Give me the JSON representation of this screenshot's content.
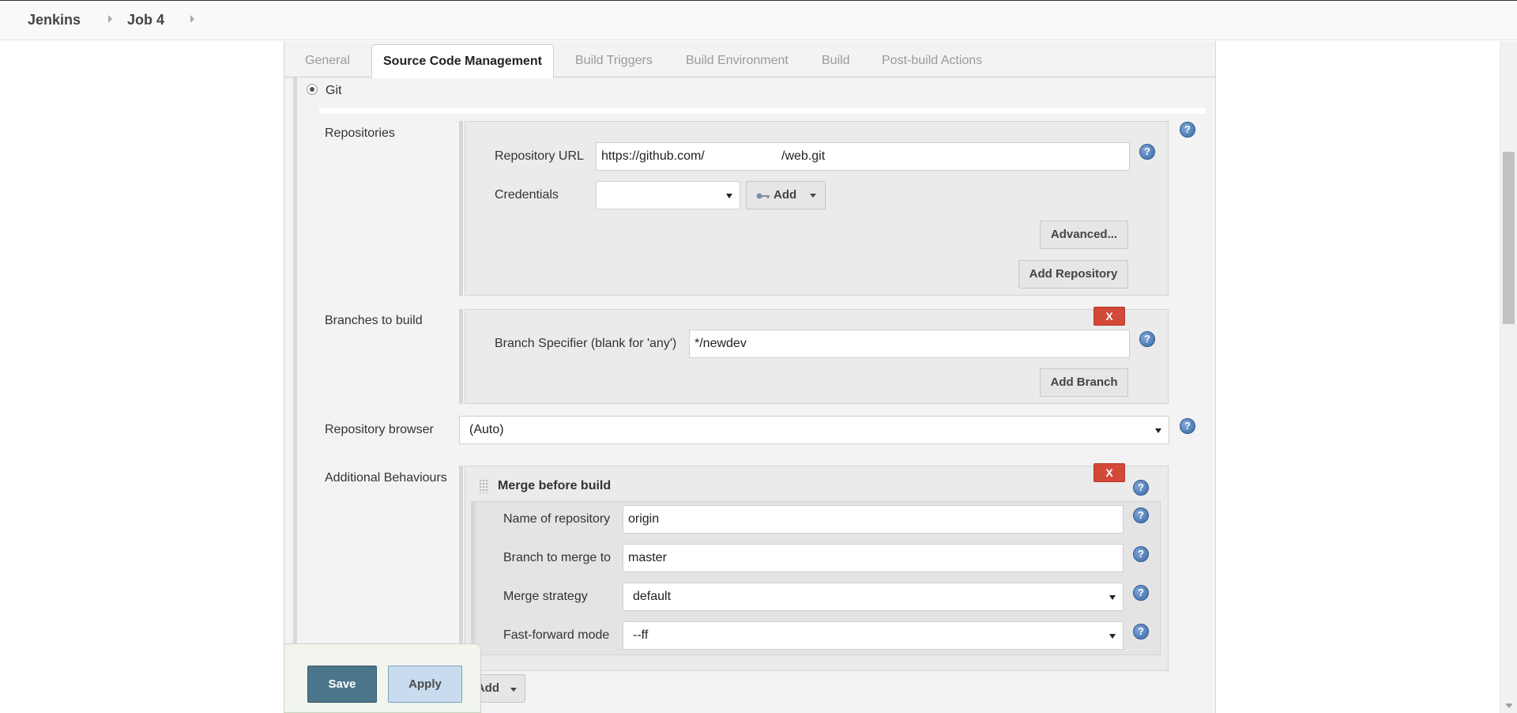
{
  "breadcrumb": {
    "root": "Jenkins",
    "job": "Job 4"
  },
  "tabs": [
    {
      "label": "General"
    },
    {
      "label": "Source Code Management"
    },
    {
      "label": "Build Triggers"
    },
    {
      "label": "Build Environment"
    },
    {
      "label": "Build"
    },
    {
      "label": "Post-build Actions"
    }
  ],
  "scm": {
    "option_label": "Git",
    "repositories": {
      "section_label": "Repositories",
      "url_label": "Repository URL",
      "url_part1": "https://github.com/",
      "url_part2": "/web.git",
      "credentials_label": "Credentials",
      "credentials_value": "",
      "add_label": "Add",
      "advanced_label": "Advanced...",
      "add_repository_label": "Add Repository"
    },
    "branches": {
      "section_label": "Branches to build",
      "specifier_label": "Branch Specifier (blank for 'any')",
      "specifier_value": "*/newdev",
      "delete_label": "X",
      "add_branch_label": "Add Branch"
    },
    "repo_browser": {
      "label": "Repository browser",
      "value": "(Auto)"
    },
    "behaviours": {
      "section_label": "Additional Behaviours",
      "title": "Merge before build",
      "delete_label": "X",
      "repo_name_label": "Name of repository",
      "repo_name_value": "origin",
      "branch_label": "Branch to merge to",
      "branch_value": "master",
      "strategy_label": "Merge strategy",
      "strategy_value": "default",
      "ff_label": "Fast-forward mode",
      "ff_value": "--ff",
      "add_label": "Add"
    }
  },
  "help_symbol": "?",
  "actions": {
    "save": "Save",
    "apply": "Apply"
  },
  "colors": {
    "accent_save": "#4b758b",
    "delete_red": "#d24939",
    "help_blue": "#3b6aa8"
  }
}
